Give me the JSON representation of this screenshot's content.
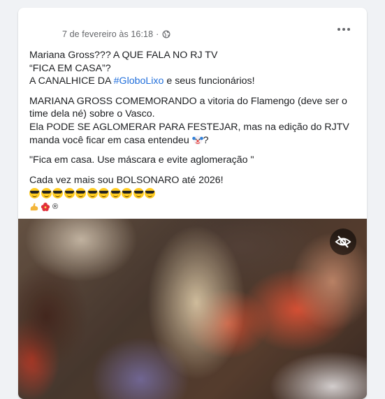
{
  "post": {
    "timestamp": "7 de fevereiro às 16:18",
    "separator": "·",
    "privacy_icon": "globe-icon",
    "more_icon": "more-options-icon",
    "text": {
      "l1": "Mariana Gross??? A QUE FALA NO RJ TV",
      "l2": "“FICA EM CASA”?",
      "l3_pre": "A CANALHICE DA ",
      "l3_hashtag": "#GloboLixo",
      "l3_post": " e seus funcionários!",
      "p2_l1": "MARIANA GROSS COMEMORANDO a vitoria do Flamengo (deve ser o",
      "p2_l2": "time dela né) sobre o Vasco.",
      "p2_l3": "Ela PODE SE AGLOMERAR PARA FESTEJAR, mas na edição do RJTV",
      "p2_l4_pre": "manda você ficar em casa entendeu ",
      "p2_l4_post": "?",
      "p3": "\"Fica em casa. Use máscara e evite aglomeração \"",
      "p4": "Cada vez mais sou BOLSONARO até 2026!",
      "registered": "®"
    },
    "emojis": {
      "clown": "clown-face-emoji",
      "sunglasses_count": 11,
      "sunglasses": "smiling-face-with-sunglasses-emoji",
      "flexed": "flexed-biceps-emoji",
      "hibiscus": "hibiscus-emoji"
    },
    "video": {
      "hide_icon": "eye-slash-icon"
    }
  },
  "colors": {
    "background": "#f0f2f5",
    "card": "#ffffff",
    "text": "#1c1e21",
    "secondary_text": "#65676b",
    "hashtag": "#216fdb"
  }
}
